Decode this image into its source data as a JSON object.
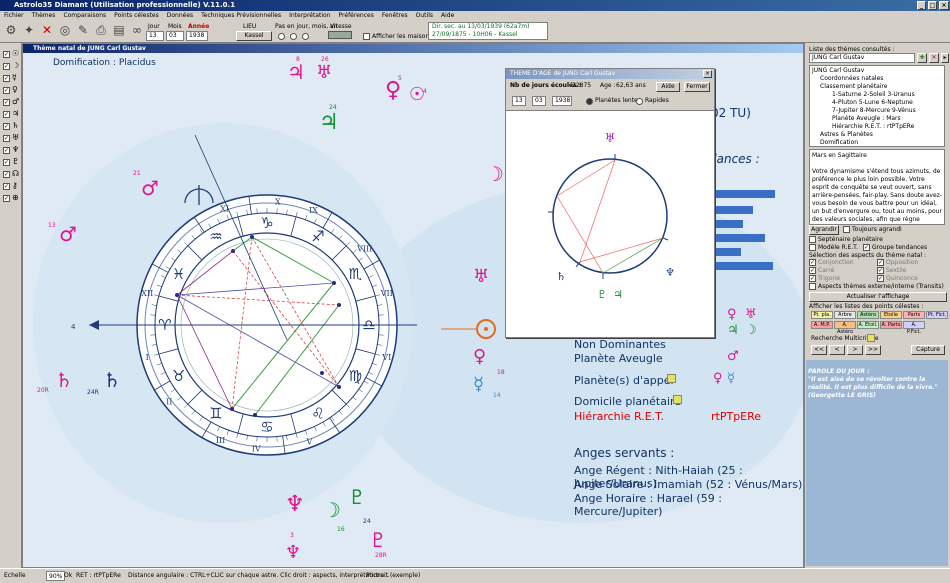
{
  "app": {
    "title": "Astrolo35 Diamant (Utilisation professionnelle) V.11.0.1"
  },
  "menu": [
    "Fichier",
    "Thèmes",
    "Comparaisons",
    "Points célestes",
    "Données",
    "Techniques Prévisionnelles",
    "Interprétation",
    "Préférences",
    "Fenêtres",
    "Outils",
    "Aide"
  ],
  "toolbar": {
    "jour_label": "Jour",
    "mois_label": "Mois",
    "annee_label": "Année",
    "jour": "13",
    "mois": "03",
    "annee": "1938",
    "lieu_label": "LIEU",
    "lieu": "Kassel",
    "pas_label": "Pas en jour, mois, an",
    "vitesse_label": "Vitesse",
    "afficher_maisons": "Afficher les maisons",
    "info_line1": "Dir. sec. au 13/03/1939 (62a7m)",
    "info_line2": "27/09/1875 - 10H06 - Kassel"
  },
  "chart": {
    "window_title": "Thème natal de JUNG Carl Gustav",
    "domification": "Domification : Placidus",
    "house_numbers": [
      "I",
      "II",
      "III",
      "IV",
      "V",
      "VI",
      "VII",
      "VIII",
      "IX",
      "X",
      "XI",
      "XII"
    ],
    "partial_tu": "02 TU)",
    "partial_tendances": "dances :",
    "non_dominantes": "Non Dominantes",
    "planete_aveugle": "Planète Aveugle",
    "planetes_appel": "Planète(s) d'appel",
    "domicile_planetaire": "Domicile planétaire",
    "hierarchie_label": "Hiérarchie R.E.T.",
    "hierarchie_value": "rtPTpERe",
    "anges_title": "Anges servants :",
    "ange_regent": "Ange Régent : Nith-Haiah (25 : Jupiter/Uranus)",
    "ange_solaire": "Ange Solaire : Imamiah (52 : Vénus/Mars)",
    "ange_horaire": "Ange Horaire : Harael (59 : Mercure/Jupiter)",
    "outer_numbers": [
      "8",
      "26",
      "5",
      "4",
      "24",
      "21",
      "13",
      "20R",
      "24R",
      "18",
      "14",
      "3",
      "16",
      "24",
      "28R",
      "6",
      "8",
      "4",
      "1"
    ]
  },
  "age_window": {
    "title": "THEME D'AGE de JUNG Carl Gustav",
    "nb_jours_label": "Nb de jours écoulés :",
    "nb_jours": "22875",
    "age_label": "Age :",
    "age": "62,63 ans",
    "aide": "Aide",
    "fermer": "Fermer",
    "jour": "13",
    "mois": "03",
    "annee": "1938",
    "planetes_lentes": "Planètes lentes",
    "rapides": "Rapides"
  },
  "right_panel": {
    "liste_label": "Liste des thèmes consultés :",
    "selected_theme": "JUNG Carl Gustav",
    "tree": [
      "JUNG Carl Gustav",
      "Coordonnées natales",
      "Classement planétaire",
      "1-Saturne 2-Soleil 3-Uranus",
      "4-Pluton 5-Lune 6-Neptune",
      "7-Jupiter 8-Mercure 9-Vénus",
      "Planète Aveugle : Mars",
      "Hiérarchie R.E.T. : rtPTpERe",
      "Astres & Planètes",
      "Domification"
    ],
    "interp_title": "Mars en Sagittaire",
    "interp_text": "Votre dynamisme s'étend tous azimuts, de préférence le plus loin possible. Votre esprit de conquête se veut ouvert, sans arrière-pensées, fair-play. Sans doute avez-vous besoin de vous battre pour un idéal, un but d'envergure ou, tout au moins, pour des valeurs sociales, afin que règne",
    "agrandir": "Agrandir",
    "toujours_agrandi": "Toujours agrandi",
    "septenaire": "Septénaire planétaire",
    "modele_ret": "Modèle R.E.T.",
    "groupe_tendances": "Groupe tendances",
    "selection_aspects": "Sélection des aspects du thème natal :",
    "aspect_items": [
      "Conjonction",
      "Opposition",
      "Carré",
      "Sextile",
      "Trigone",
      "Quinconce"
    ],
    "aspects_externe": "Aspects thèmes externe/interne (Transits)",
    "actualiser": "Actualiser l'affichage",
    "afficher_listes": "Afficher les listes des points célestes :",
    "list_buttons": [
      "Pt. pla.",
      "Arbre",
      "Astéro",
      "Etoile",
      "Parts",
      "Pt. Fict.",
      "A. M.P.",
      "A. Astéro",
      "A. Etoil.",
      "A. Parts",
      "A. P.Fict."
    ],
    "recherche": "Recherche Multicritère",
    "nav_buttons": [
      "<<",
      "<",
      ">",
      ">>"
    ],
    "capture": "Capture",
    "parole_title": "PAROLE DU JOUR :",
    "parole_text": "\"Il est aisé de se révolter contre la réalité. Il est plus difficile de la vivre.\"",
    "parole_author": "(Georgette LE GRIS)"
  },
  "status": {
    "echelle": "Echelle",
    "echelle_value": "90%",
    "ok": "Ok",
    "ret": "RET : rtPTpERe",
    "hint": "Distance angulaire : CTRL+CLIC sur chaque astre. Clic droit : aspects, interprétations...",
    "portrait": "Portrait (exemple)"
  },
  "colors": {
    "title_blue": "#0a246a",
    "chart_text": "#0a2a6a",
    "planet_magenta": "#e0148c",
    "planet_green": "#109030",
    "planet_navy": "#1b2f7a",
    "red_text": "#e00000",
    "bar_blue": "#3a6fc6"
  }
}
